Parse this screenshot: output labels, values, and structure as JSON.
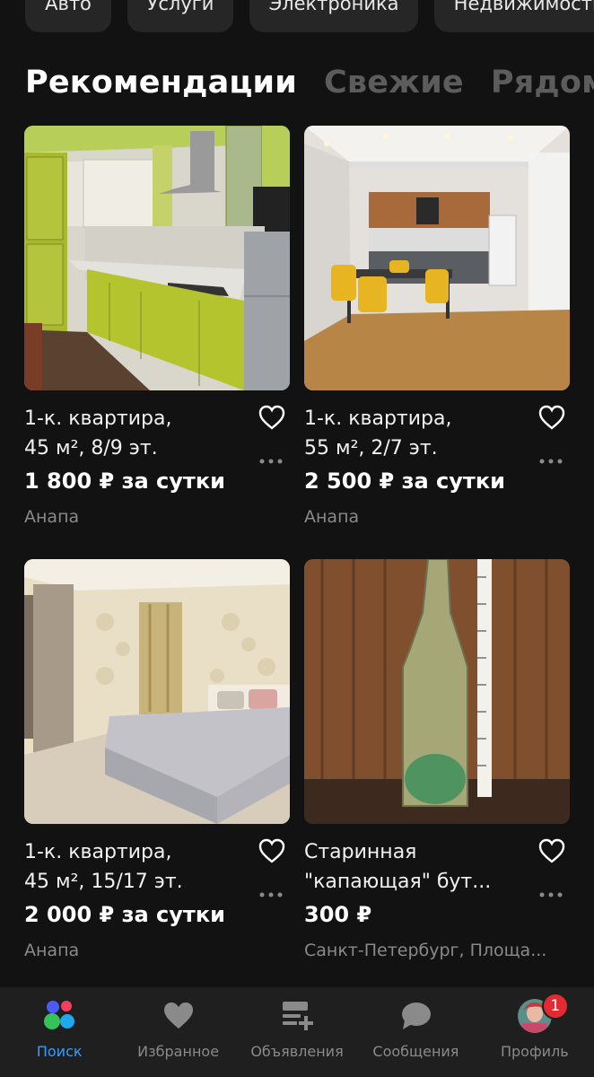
{
  "categories": [
    "Авто",
    "Услуги",
    "Электроника",
    "Недвижимость"
  ],
  "feed_tabs": [
    "Рекомендации",
    "Свежие",
    "Рядом с"
  ],
  "listings": [
    {
      "title_line1": "1-к. квартира,",
      "title_line2": "45 м², 8/9 эт.",
      "price": "1 800 ₽ за сутки",
      "city": "Анапа"
    },
    {
      "title_line1": "1-к. квартира,",
      "title_line2": "55 м², 2/7 эт.",
      "price": "2 500 ₽ за сутки",
      "city": "Анапа"
    },
    {
      "title_line1": "1-к. квартира,",
      "title_line2": "45 м², 15/17 эт.",
      "price": "2 000 ₽ за сутки",
      "city": "Анапа"
    },
    {
      "title_line1": "Старинная",
      "title_line2": "\"капающая\" бут...",
      "price": "300 ₽",
      "city": "Санкт-Петербург, Площа..."
    }
  ],
  "nav": {
    "items": [
      {
        "label": "Поиск",
        "icon": "search-dots-icon"
      },
      {
        "label": "Избранное",
        "icon": "heart-icon"
      },
      {
        "label": "Объявления",
        "icon": "listings-add-icon"
      },
      {
        "label": "Сообщения",
        "icon": "chat-bubble-icon"
      },
      {
        "label": "Профиль",
        "icon": "avatar"
      }
    ],
    "profile_badge": "1",
    "active_color": "#3d9bf5"
  }
}
